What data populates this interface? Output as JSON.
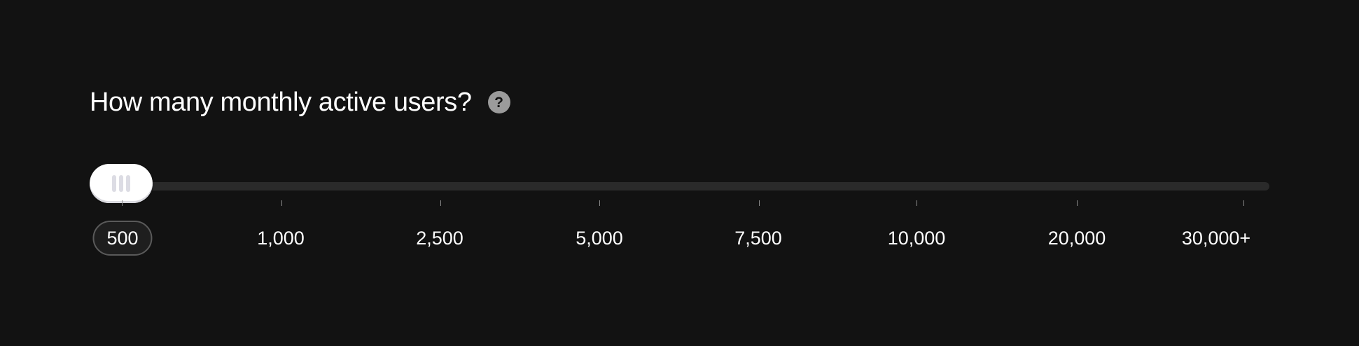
{
  "question": {
    "title": "How many monthly active users?",
    "help_icon": "question-circle-icon"
  },
  "slider": {
    "selected_index": 0,
    "selected_value": "500",
    "thumb_icon": "grip-icon",
    "stops": [
      "500",
      "1,000",
      "2,500",
      "5,000",
      "7,500",
      "10,000",
      "20,000",
      "30,000+"
    ]
  },
  "colors": {
    "background": "#121212",
    "track": "#2a2a2a",
    "thumb": "#ffffff",
    "help_icon_bg": "#9b9b9b",
    "selected_border": "#5a5a5a"
  }
}
